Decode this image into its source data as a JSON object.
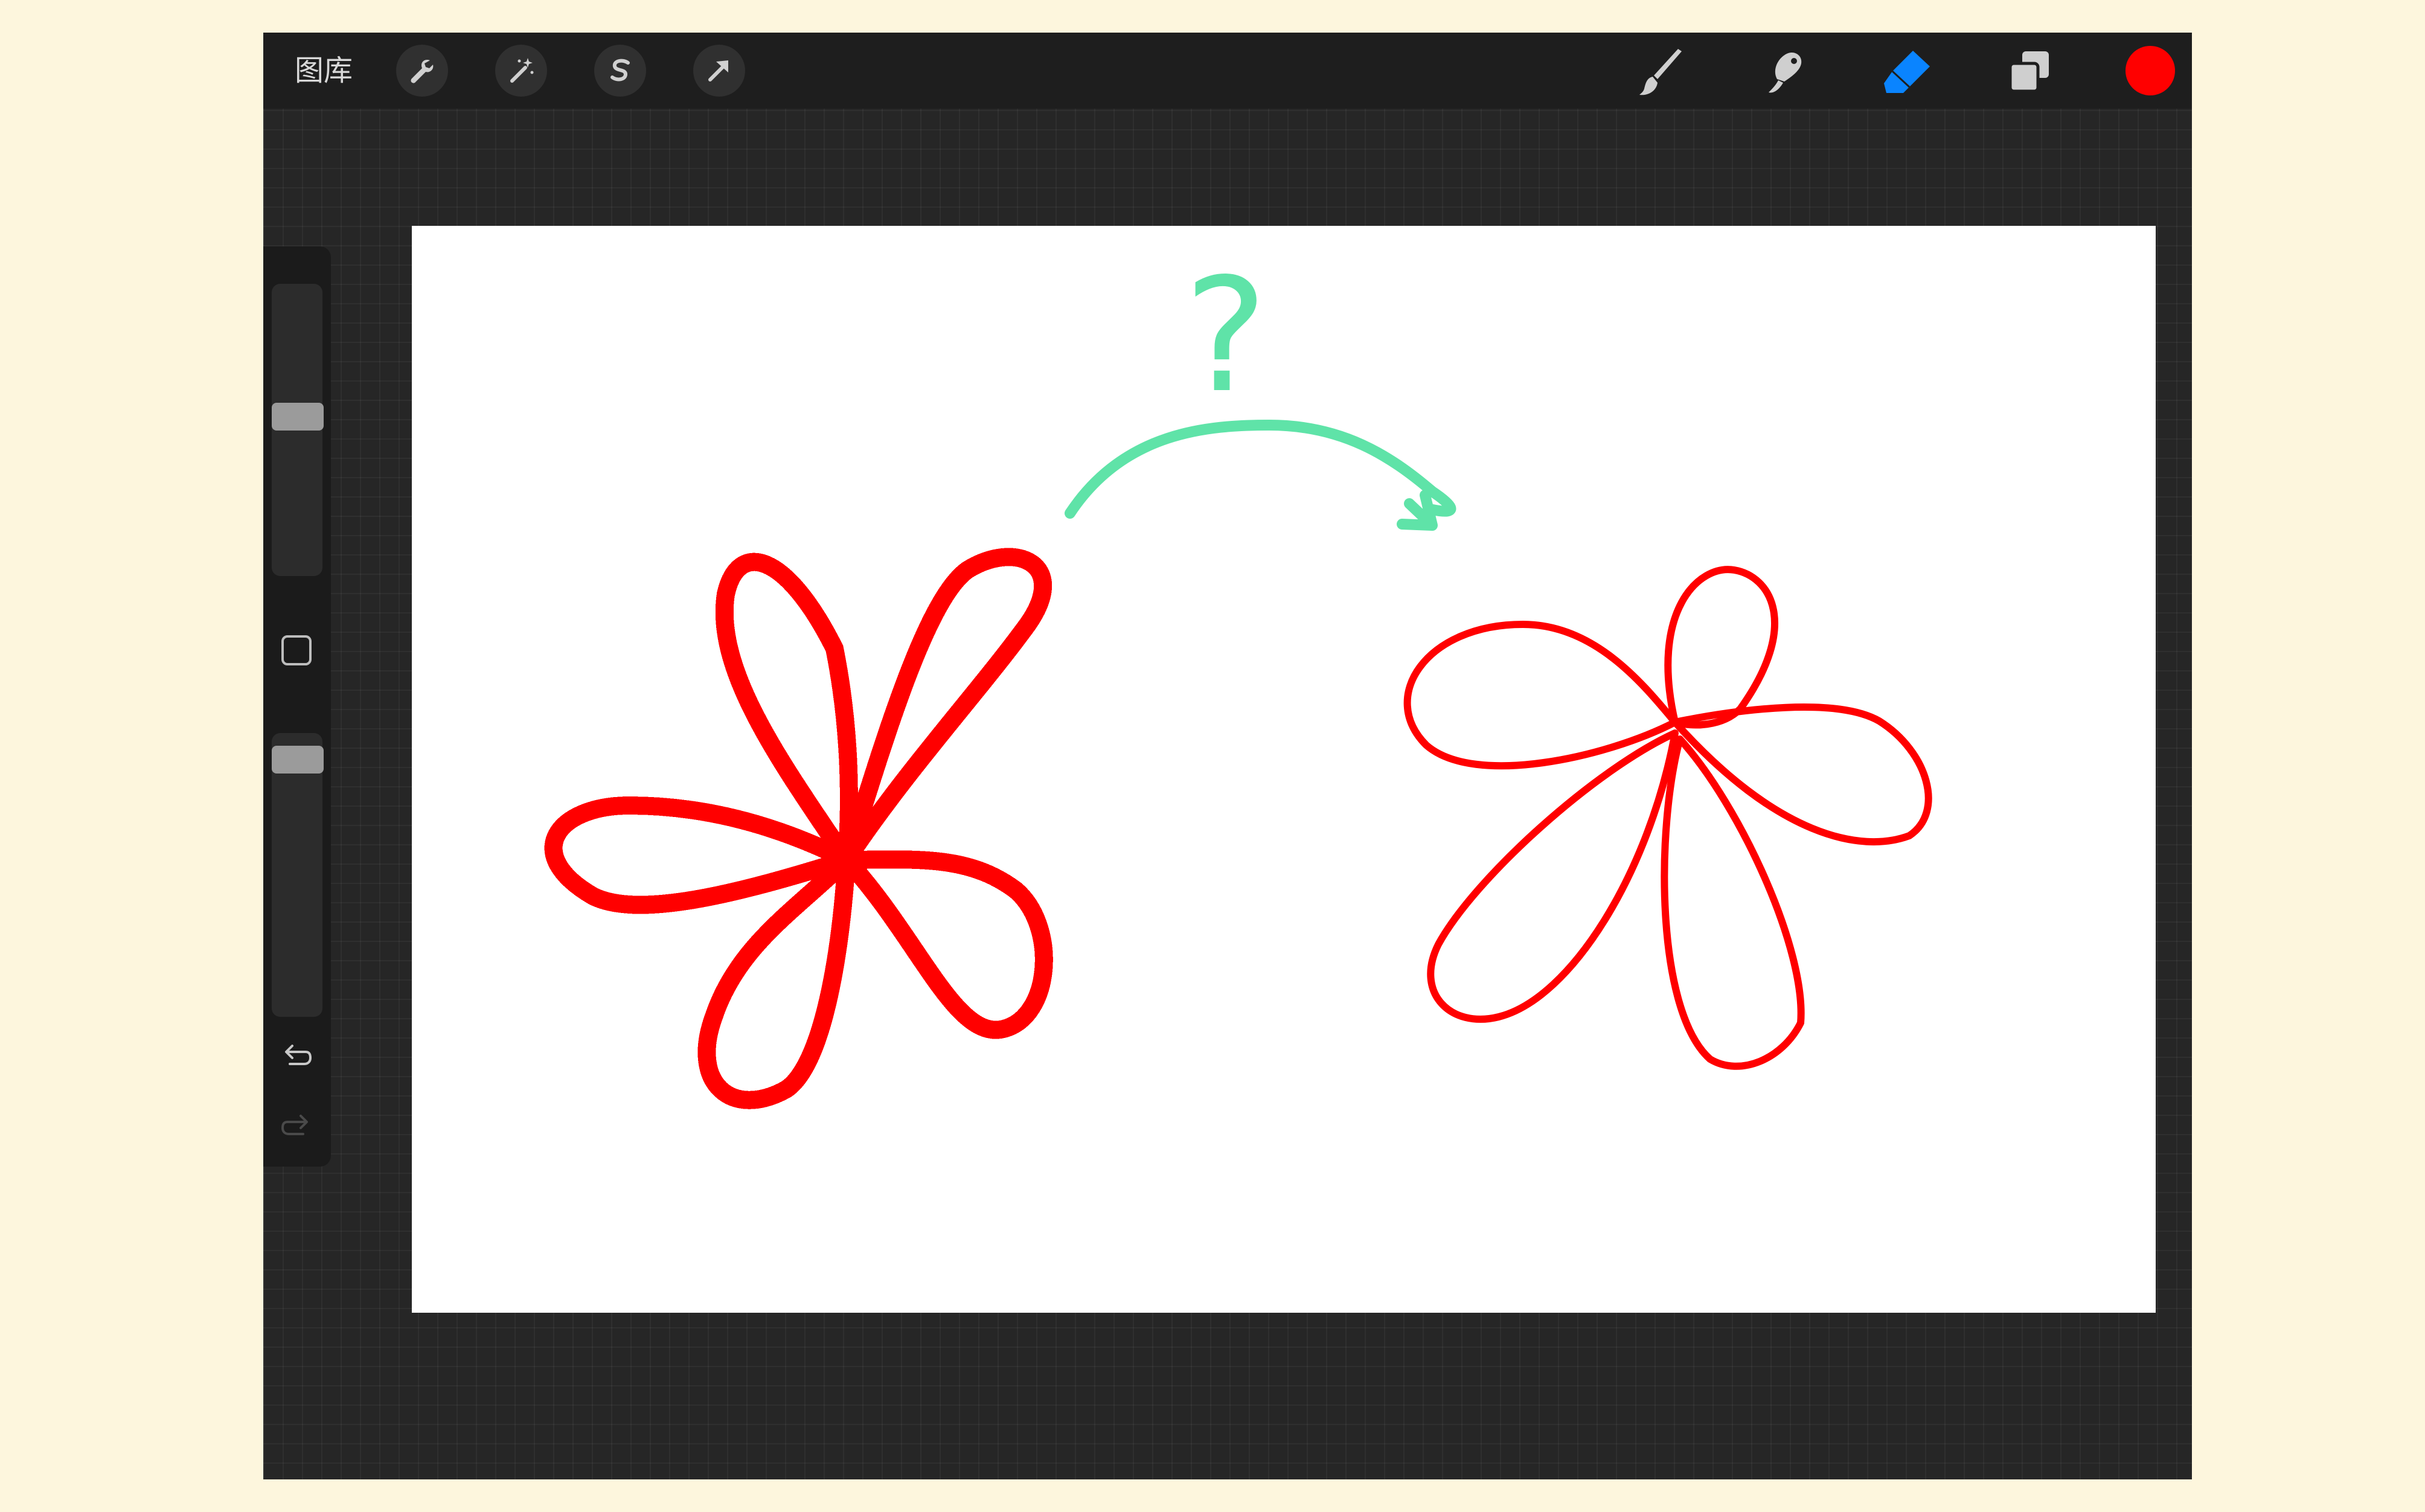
{
  "topbar": {
    "gallery_label": "图库",
    "left_tools": [
      "wrench-icon",
      "magic-wand-icon",
      "selection-icon",
      "transform-arrow-icon"
    ],
    "right_tools": [
      "brush-icon",
      "smudge-icon",
      "eraser-icon",
      "layers-icon"
    ],
    "active_tool": "eraser",
    "current_color": "#FF0000"
  },
  "sidebar": {
    "brush_size_level": 0.55,
    "opacity_level": 0.95,
    "controls": [
      "modify-button",
      "undo-icon",
      "redo-icon"
    ]
  },
  "canvas": {
    "stroke_color": "#FF0000",
    "annotation_color": "#5FE3A8",
    "annotation_text": "?"
  }
}
